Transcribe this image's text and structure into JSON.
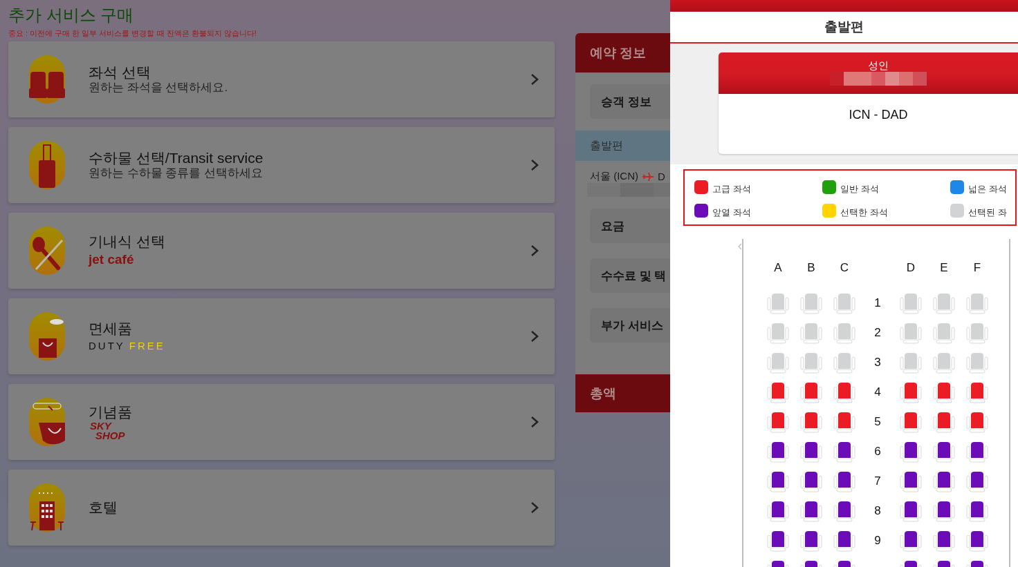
{
  "page": {
    "title": "추가 서비스 구매",
    "notice": "중요 : 이전에 구매 한 일부 서비스를 변경할 때 잔액은 환불되지 않습니다!"
  },
  "services": [
    {
      "kind": "seat",
      "title": "좌석 선택",
      "subtitle": {
        "kind": "plain",
        "parts": [
          "원하는 좌석을 선택하세요."
        ]
      }
    },
    {
      "kind": "luggage",
      "title": "수하물 선택/Transit service",
      "subtitle": {
        "kind": "plain",
        "parts": [
          "원하는 수하물 종류를 선택하세요"
        ]
      }
    },
    {
      "kind": "meal",
      "title": "기내식 선택",
      "subtitle": {
        "kind": "jet",
        "parts": [
          "jet café"
        ]
      }
    },
    {
      "kind": "dutyfree",
      "title": "면세품",
      "subtitle": {
        "kind": "duty",
        "parts": [
          "DUTY",
          "FREE"
        ]
      }
    },
    {
      "kind": "souvenir",
      "title": "기념품",
      "subtitle": {
        "kind": "sky",
        "parts": [
          "SKY",
          "SHOP"
        ]
      }
    },
    {
      "kind": "hotel",
      "title": "호텔"
    }
  ],
  "booking": {
    "header": "예약 정보",
    "items": [
      {
        "kind": "box",
        "label": "승객 정보"
      },
      {
        "kind": "band",
        "label": "출발편"
      },
      {
        "kind": "route",
        "from": "서울 (ICN)",
        "to": "D"
      },
      {
        "kind": "box",
        "label": "요금"
      },
      {
        "kind": "box",
        "label": "수수료 및 택"
      },
      {
        "kind": "box",
        "label": "부가 서비스"
      }
    ],
    "total": "총액"
  },
  "drawer": {
    "title": "출발편",
    "passenger": {
      "type": "성인",
      "route": "ICN - DAD"
    },
    "legend": [
      {
        "kind": "premium",
        "label": "고급 좌석",
        "color": "#ec1c24"
      },
      {
        "kind": "standard",
        "label": "일반 좌석",
        "color": "#21a00e"
      },
      {
        "kind": "wide",
        "label": "넓은 좌석",
        "color": "#1e88e8"
      },
      {
        "kind": "front",
        "label": "앞열 좌석",
        "color": "#6c0bb8"
      },
      {
        "kind": "chosen",
        "label": "선택한 좌석",
        "color": "#ffd400"
      },
      {
        "kind": "taken",
        "label": "선택된 좌",
        "color": "#d2d3d5"
      }
    ],
    "columns_left": [
      "A",
      "B",
      "C"
    ],
    "columns_right": [
      "D",
      "E",
      "F"
    ],
    "rows": [
      {
        "number": "1",
        "kind": "taken"
      },
      {
        "number": "2",
        "kind": "taken"
      },
      {
        "number": "3",
        "kind": "taken"
      },
      {
        "number": "4",
        "kind": "premium"
      },
      {
        "number": "5",
        "kind": "premium"
      },
      {
        "number": "6",
        "kind": "front"
      },
      {
        "number": "7",
        "kind": "front"
      },
      {
        "number": "8",
        "kind": "front"
      },
      {
        "number": "9",
        "kind": "front"
      },
      {
        "kind": "front"
      }
    ]
  }
}
